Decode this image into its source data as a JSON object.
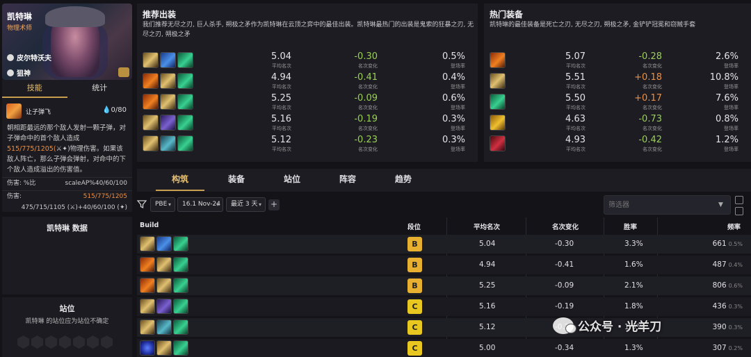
{
  "champion": {
    "name": "凯特琳",
    "role": "物理术师",
    "trait1": "皮尔特沃夫",
    "trait2": "狙神"
  },
  "skill_tabs": [
    "技能",
    "统计"
  ],
  "skill": {
    "name": "让子弹飞",
    "mana": "0/80",
    "desc_1": "朝相距最远的那个敌人发射一颗子弹，对子弹命中的首个敌人造成",
    "desc_dmg": "515/775/1205",
    "desc_2": "(",
    "desc_3": ")物理伤害。如果该敌人阵亡，那么子弹会弹射，对命中的下个敌人造成溢出的伤害值。",
    "stat1_label": "伤害: %比",
    "stat1_value": "scaleAP%40/60/100",
    "stat2_label": "伤害:",
    "stat2_value": "515/775/1205",
    "stat3_a": "475/715/1105 (",
    "stat3_b": ")+40/60/100 (",
    "stat3_c": ")"
  },
  "data_title": "凯特琳 数据",
  "position": {
    "title": "站位",
    "sub": "凯特琳 的站位应为站位不确定"
  },
  "rec": {
    "title": "推荐出装",
    "desc": "我们推荐无尽之刃, 巨人杀手, 朔极之矛作为凯特琳在云顶之弈中的最佳出装。凯特琳最热门的出装是鬼索的狂暴之刃, 无尽之刃, 朔极之矛",
    "label_place": "平均名次",
    "label_change": "名次变化",
    "label_rate": "登场率",
    "rows": [
      {
        "icons": [
          "gold",
          "blue",
          "green"
        ],
        "place": "5.04",
        "change": "-0.30",
        "rate": "0.5%"
      },
      {
        "icons": [
          "fire",
          "gold",
          "green"
        ],
        "place": "4.94",
        "change": "-0.41",
        "rate": "0.4%"
      },
      {
        "icons": [
          "fire",
          "gold",
          "green"
        ],
        "place": "5.25",
        "change": "-0.09",
        "rate": "0.6%"
      },
      {
        "icons": [
          "gold",
          "purple",
          "green"
        ],
        "place": "5.16",
        "change": "-0.19",
        "rate": "0.3%"
      },
      {
        "icons": [
          "gold",
          "teal",
          "green"
        ],
        "place": "5.12",
        "change": "-0.23",
        "rate": "0.3%"
      }
    ]
  },
  "hot": {
    "title": "热门装备",
    "desc": "凯特琳的最佳装备是死亡之刃, 无尽之刃, 朔极之矛, 金铲铲冠冕和窃贼手套",
    "rows": [
      {
        "icon": "fire",
        "place": "5.07",
        "change": "-0.28",
        "rate": "2.6%"
      },
      {
        "icon": "gold",
        "place": "5.51",
        "change": "+0.18",
        "rate": "10.8%"
      },
      {
        "icon": "green",
        "place": "5.50",
        "change": "+0.17",
        "rate": "7.6%"
      },
      {
        "icon": "crown",
        "place": "4.63",
        "change": "-0.73",
        "rate": "0.8%"
      },
      {
        "icon": "red",
        "place": "4.93",
        "change": "-0.42",
        "rate": "1.2%"
      }
    ]
  },
  "main_tabs": [
    "构筑",
    "装备",
    "站位",
    "阵容",
    "趋势"
  ],
  "filters": {
    "patch": "PBE",
    "version": "16.1 Nov-24",
    "range": "最近 3 天",
    "plus": "+",
    "placeholder": "筛选器"
  },
  "table": {
    "headers": [
      "Build",
      "段位",
      "平均名次",
      "名次变化",
      "胜率",
      "频率"
    ],
    "rows": [
      {
        "icons": [
          "gold",
          "blue",
          "green"
        ],
        "tier": "B",
        "place": "5.04",
        "change": "-0.30",
        "win": "3.3%",
        "freq": "661",
        "freq_pct": "0.5%"
      },
      {
        "icons": [
          "fire",
          "gold",
          "green"
        ],
        "tier": "B",
        "place": "4.94",
        "change": "-0.41",
        "win": "1.6%",
        "freq": "487",
        "freq_pct": "0.4%"
      },
      {
        "icons": [
          "fire",
          "gold",
          "green"
        ],
        "tier": "B",
        "place": "5.25",
        "change": "-0.09",
        "win": "2.1%",
        "freq": "806",
        "freq_pct": "0.6%"
      },
      {
        "icons": [
          "gold",
          "purple",
          "green"
        ],
        "tier": "C",
        "place": "5.16",
        "change": "-0.19",
        "win": "1.8%",
        "freq": "436",
        "freq_pct": "0.3%"
      },
      {
        "icons": [
          "gold",
          "teal",
          "green"
        ],
        "tier": "C",
        "place": "5.12",
        "change": "-0.23",
        "win": "1.6%",
        "freq": "390",
        "freq_pct": "0.3%"
      },
      {
        "icons": [
          "orb",
          "gold",
          "green"
        ],
        "tier": "C",
        "place": "5.00",
        "change": "-0.34",
        "win": "1.3%",
        "freq": "307",
        "freq_pct": "0.2%"
      }
    ]
  },
  "watermark": "公众号 · 光羊刀",
  "colors": {
    "accent": "#c8a050",
    "positive": "#9ad058",
    "negative": "#f09040",
    "tierB": "#e8b030",
    "tierC": "#e8c820"
  }
}
